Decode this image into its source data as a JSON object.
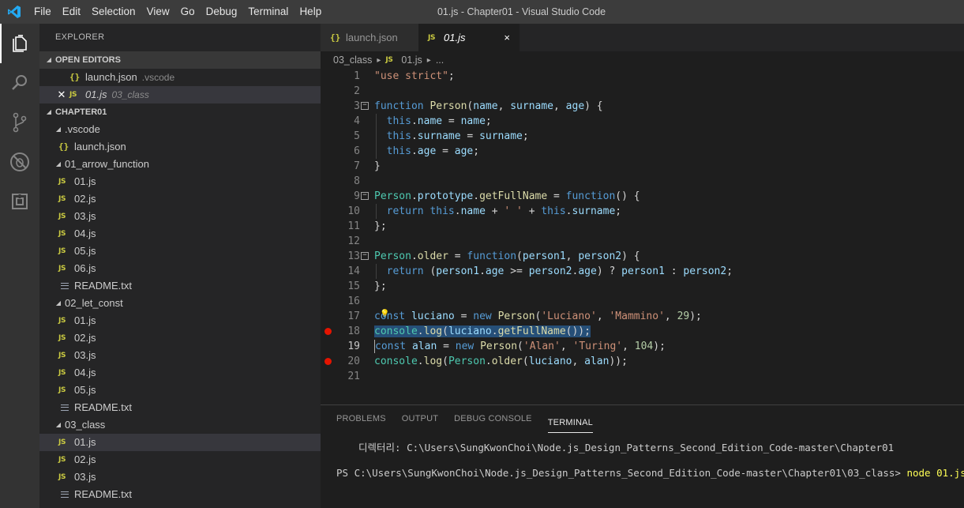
{
  "window": {
    "title": "01.js - Chapter01 - Visual Studio Code",
    "menu": [
      "File",
      "Edit",
      "Selection",
      "View",
      "Go",
      "Debug",
      "Terminal",
      "Help"
    ]
  },
  "activity_bar": {
    "icons": [
      "files-icon",
      "search-icon",
      "source-control-icon",
      "debug-icon",
      "extensions-icon"
    ]
  },
  "sidebar": {
    "title": "EXPLORER",
    "open_editors": {
      "header": "OPEN EDITORS",
      "items": [
        {
          "icon": "{}",
          "name": "launch.json",
          "desc": ".vscode"
        },
        {
          "icon": "JS",
          "name": "01.js",
          "desc": "03_class"
        }
      ]
    },
    "folder": {
      "header": "CHAPTER01",
      "items": [
        {
          "depth": 1,
          "type": "folder",
          "name": ".vscode"
        },
        {
          "depth": 1,
          "type": "json",
          "name": "launch.json"
        },
        {
          "depth": 1,
          "type": "folder",
          "name": "01_arrow_function"
        },
        {
          "depth": 1,
          "type": "js",
          "name": "01.js"
        },
        {
          "depth": 1,
          "type": "js",
          "name": "02.js"
        },
        {
          "depth": 1,
          "type": "js",
          "name": "03.js"
        },
        {
          "depth": 1,
          "type": "js",
          "name": "04.js"
        },
        {
          "depth": 1,
          "type": "js",
          "name": "05.js"
        },
        {
          "depth": 1,
          "type": "js",
          "name": "06.js"
        },
        {
          "depth": 1,
          "type": "txt",
          "name": "README.txt"
        },
        {
          "depth": 1,
          "type": "folder",
          "name": "02_let_const"
        },
        {
          "depth": 1,
          "type": "js",
          "name": "01.js"
        },
        {
          "depth": 1,
          "type": "js",
          "name": "02.js"
        },
        {
          "depth": 1,
          "type": "js",
          "name": "03.js"
        },
        {
          "depth": 1,
          "type": "js",
          "name": "04.js"
        },
        {
          "depth": 1,
          "type": "js",
          "name": "05.js"
        },
        {
          "depth": 1,
          "type": "txt",
          "name": "README.txt"
        },
        {
          "depth": 1,
          "type": "folder",
          "name": "03_class"
        },
        {
          "depth": 1,
          "type": "js",
          "name": "01.js",
          "selected": true
        },
        {
          "depth": 1,
          "type": "js",
          "name": "02.js"
        },
        {
          "depth": 1,
          "type": "js",
          "name": "03.js"
        },
        {
          "depth": 1,
          "type": "txt",
          "name": "README.txt"
        }
      ]
    }
  },
  "tabs": [
    {
      "icon": "{}",
      "label": "launch.json",
      "active": false
    },
    {
      "icon": "JS",
      "label": "01.js",
      "active": true,
      "close": "×"
    }
  ],
  "breadcrumb": {
    "folder": "03_class",
    "file_icon": "JS",
    "file": "01.js",
    "more": "..."
  },
  "editor": {
    "lines": [
      "\"use strict\";",
      "",
      "function Person(name, surname, age) {",
      "  this.name = name;",
      "  this.surname = surname;",
      "  this.age = age;",
      "}",
      "",
      "Person.prototype.getFullName = function() {",
      "  return this.name + ' ' + this.surname;",
      "};",
      "",
      "Person.older = function(person1, person2) {",
      "  return (person1.age >= person2.age) ? person1 : person2;",
      "};",
      "",
      "const luciano = new Person('Luciano', 'Mammino', 29);",
      "console.log(luciano.getFullName());",
      "const alan = new Person('Alan', 'Turing', 104);",
      "console.log(Person.older(luciano, alan));",
      ""
    ],
    "line_numbers": [
      "1",
      "2",
      "3",
      "4",
      "5",
      "6",
      "7",
      "8",
      "9",
      "10",
      "11",
      "12",
      "13",
      "14",
      "15",
      "16",
      "17",
      "18",
      "19",
      "20",
      "21"
    ],
    "breakpoints": [
      18,
      20
    ],
    "current_line": 19,
    "selected_line": 18,
    "folds": [
      3,
      9,
      13
    ]
  },
  "panel": {
    "tabs": [
      "PROBLEMS",
      "OUTPUT",
      "DEBUG CONSOLE",
      "TERMINAL"
    ],
    "active_tab": "TERMINAL",
    "terminal": {
      "line1_label": "디렉터리:",
      "line1_path": "C:\\Users\\SungKwonChoi\\Node.js_Design_Patterns_Second_Edition_Code-master\\Chapter01",
      "prompt": "PS C:\\Users\\SungKwonChoi\\Node.js_Design_Patterns_Second_Edition_Code-master\\Chapter01\\03_class>",
      "command": "node 01.js"
    }
  },
  "colors": {
    "accent": "#007acc",
    "breakpoint": "#e51400",
    "js_icon": "#cbcb41"
  }
}
